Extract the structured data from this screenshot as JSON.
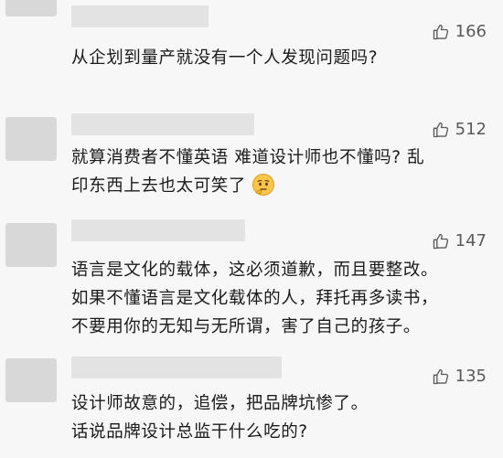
{
  "comments": [
    {
      "likes": "166",
      "lines": [
        "从企划到量产就没有一个人发现问题吗?"
      ]
    },
    {
      "likes": "512",
      "lines": [
        "就算消费者不懂英语 难道设计师也不懂吗? 乱",
        "印东西上去也太可笑了"
      ],
      "emoji": "thinking-face-emoji"
    },
    {
      "likes": "147",
      "lines": [
        "语言是文化的载体，这必须道歉，而且要整改。",
        "如果不懂语言是文化载体的人，拜托再多读书，",
        "不要用你的无知与无所谓，害了自己的孩子。"
      ]
    },
    {
      "likes": "135",
      "lines": [
        "设计师故意的，追偿，把品牌坑惨了。",
        "话说品牌设计总监干什么吃的?"
      ]
    }
  ],
  "icons": {
    "like": "thumbs-up-icon"
  },
  "colors": {
    "background": "#f7f7f7",
    "text": "#1b1b1b",
    "like_count": "#5a5a5a",
    "redaction": "#e3e3e3"
  }
}
